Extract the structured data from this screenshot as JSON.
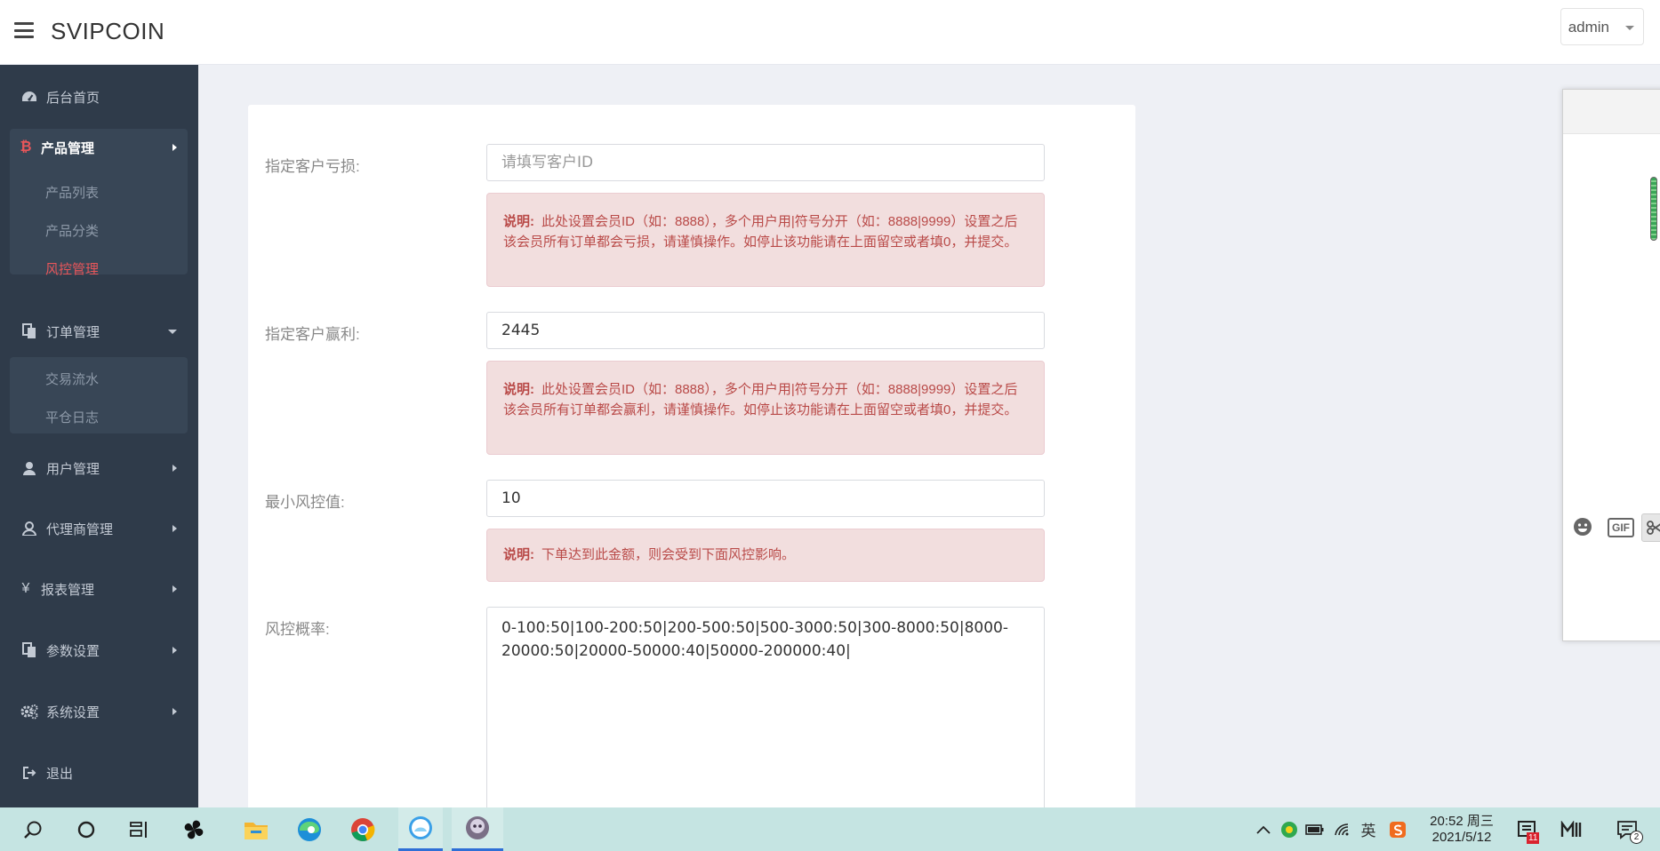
{
  "header": {
    "brand": "SVIPCOIN",
    "user": "admin"
  },
  "sidebar": {
    "items": [
      {
        "label": "后台首页",
        "icon": "dashboard-icon"
      },
      {
        "label": "产品管理",
        "icon": "bitcoin-icon",
        "expanded": true,
        "children": [
          "产品列表",
          "产品分类",
          "风控管理"
        ],
        "active_child": "风控管理"
      },
      {
        "label": "订单管理",
        "icon": "copy-icon",
        "expanded": true,
        "children": [
          "交易流水",
          "平仓日志"
        ]
      },
      {
        "label": "用户管理",
        "icon": "user-icon"
      },
      {
        "label": "代理商管理",
        "icon": "agent-icon"
      },
      {
        "label": "报表管理",
        "icon": "yen-icon"
      },
      {
        "label": "参数设置",
        "icon": "copy-icon"
      },
      {
        "label": "系统设置",
        "icon": "gears-icon"
      },
      {
        "label": "退出",
        "icon": "sign-out-icon"
      }
    ]
  },
  "form": {
    "loss": {
      "label": "指定客户亏损:",
      "value": "",
      "placeholder": "请填写客户ID",
      "note_title": "说明:",
      "note": "此处设置会员ID（如：8888），多个用户用|符号分开（如：8888|9999）设置之后该会员所有订单都会亏损，请谨慎操作。如停止该功能请在上面留空或者填0，并提交。"
    },
    "win": {
      "label": "指定客户赢利:",
      "value": "2445",
      "note_title": "说明:",
      "note": "此处设置会员ID（如：8888），多个用户用|符号分开（如：8888|9999）设置之后该会员所有订单都会赢利，请谨慎操作。如停止该功能请在上面留空或者填0，并提交。"
    },
    "min_risk": {
      "label": "最小风控值:",
      "value": "10",
      "note_title": "说明:",
      "note": "下单达到此金额，则会受到下面风控影响。"
    },
    "risk_rate": {
      "label": "风控概率:",
      "value": "0-100:50|100-200:50|200-500:50|500-3000:50|300-8000:50|8000-20000:50|20000-50000:40|50000-200000:40|"
    }
  },
  "widget": {
    "gif_label": "GIF"
  },
  "taskbar": {
    "time": "20:52 周三",
    "date": "2021/5/12",
    "ime": "英",
    "mail_badge": "11",
    "notif_badge": "2"
  },
  "colors": {
    "sidebar_bg": "#2f3b4a",
    "accent_red": "#e8565a",
    "note_bg": "#f2dede",
    "note_text": "#b94a48",
    "taskbar_bg": "#c5e4e2"
  }
}
